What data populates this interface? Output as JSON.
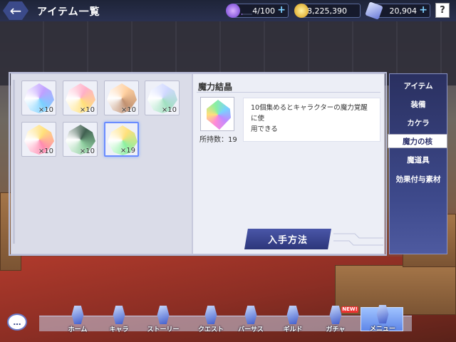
{
  "header": {
    "title": "アイテム一覧",
    "back_icon": "arrow-left-icon"
  },
  "resources": {
    "stamina": {
      "value": "4/100",
      "fill_fraction": 0.04,
      "icon": "purple-flame-icon",
      "color": "#b37bff"
    },
    "coins": {
      "value": "28,225,390",
      "icon": "gold-coin-icon",
      "color": "#f3c43a"
    },
    "crystals": {
      "value": "20,904",
      "icon": "crystal-icon",
      "color": "#9fb3ff"
    },
    "plus_label": "+",
    "help_label": "?"
  },
  "items": [
    {
      "count": "×10",
      "colors": [
        "#c0a0ff",
        "#7ad0ff"
      ]
    },
    {
      "count": "×10",
      "colors": [
        "#ffb0c8",
        "#ffe07a"
      ]
    },
    {
      "count": "×10",
      "colors": [
        "#ffd0a0",
        "#c09070"
      ]
    },
    {
      "count": "×10",
      "colors": [
        "#d0d8ff",
        "#a0e0c0"
      ]
    },
    {
      "count": "×10",
      "colors": [
        "#ffe07a",
        "#ff8ab0"
      ]
    },
    {
      "count": "×10",
      "colors": [
        "#406050",
        "#90d0a0"
      ]
    },
    {
      "count": "×19",
      "colors": [
        "#ffe07a",
        "#8af0a0"
      ],
      "selected": true
    }
  ],
  "detail": {
    "name": "魔力結晶",
    "owned": "所持数：19",
    "description_line1": "10個集めるとキャラクターの魔力覚醒に使",
    "description_line2": "用できる",
    "acquire_button": "入手方法"
  },
  "categories": [
    {
      "label": "アイテム",
      "active": false
    },
    {
      "label": "装備",
      "active": false
    },
    {
      "label": "カケラ",
      "active": false
    },
    {
      "label": "魔力の核",
      "active": true
    },
    {
      "label": "魔道具",
      "active": false
    },
    {
      "label": "効果付与素材",
      "active": false
    }
  ],
  "nav": [
    {
      "label": "ホーム",
      "icon": "home-tower-icon",
      "active": false
    },
    {
      "label": "キャラ",
      "icon": "character-icon",
      "active": false
    },
    {
      "label": "ストーリー",
      "icon": "story-book-icon",
      "active": false
    },
    {
      "label": "クエスト",
      "icon": "quest-sword-icon",
      "active": false
    },
    {
      "label": "バーサス",
      "icon": "versus-swords-icon",
      "active": false
    },
    {
      "label": "ギルド",
      "icon": "guild-shield-icon",
      "active": false
    },
    {
      "label": "ガチャ",
      "icon": "gacha-crystal-icon",
      "active": false
    },
    {
      "label": "メニュー",
      "icon": "menu-icon",
      "active": true
    }
  ],
  "new_badge": "NEW!",
  "chat_label": "…"
}
